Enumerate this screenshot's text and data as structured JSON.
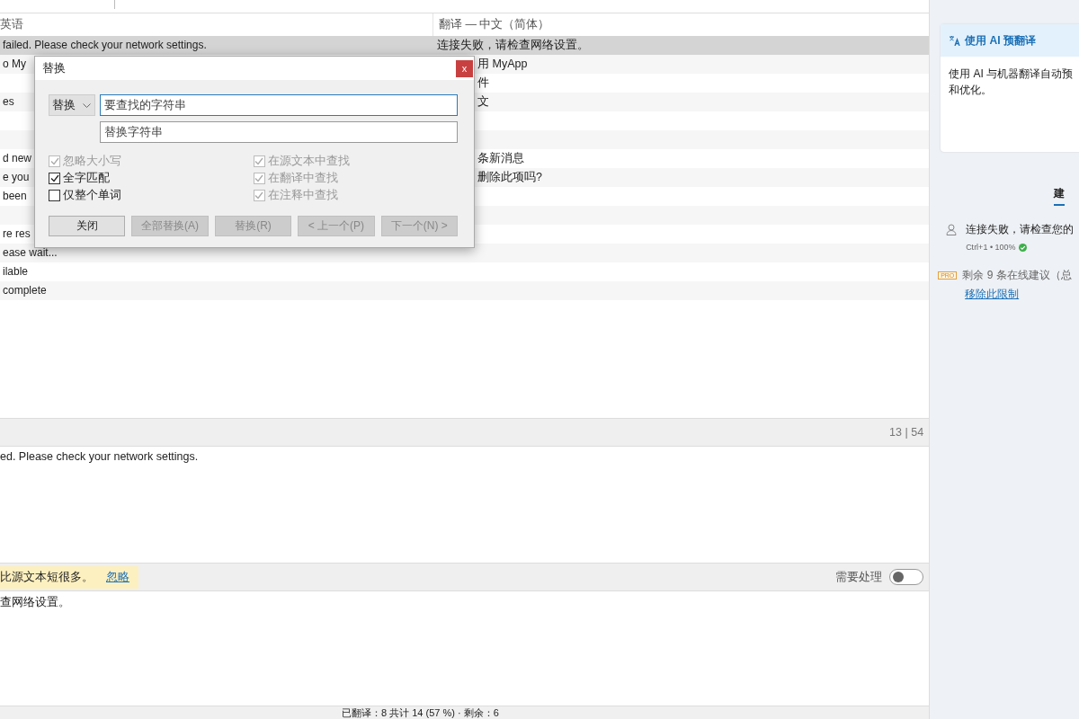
{
  "list": {
    "columns": [
      "英语",
      "翻译 — 中文（简体）"
    ],
    "rows": [
      {
        "source": "failed. Please check your network settings.",
        "translation": "连接失败，请检查网络设置。",
        "selected": true
      },
      {
        "source": "o My",
        "translation": "用 MyApp",
        "selected": false
      },
      {
        "source": "",
        "translation": "件",
        "selected": false
      },
      {
        "source": "es",
        "translation": "文",
        "selected": false
      },
      {
        "source": "",
        "translation": "",
        "selected": false
      },
      {
        "source": "",
        "translation": "",
        "selected": false
      },
      {
        "source": "d new",
        "translation": "条新消息",
        "selected": false
      },
      {
        "source": "e you",
        "translation": "删除此项吗?",
        "selected": false
      },
      {
        "source": "been",
        "translation": "",
        "selected": false
      },
      {
        "source": "",
        "translation": "",
        "selected": false
      },
      {
        "source": "re res",
        "translation": "",
        "selected": false
      },
      {
        "source": "ease wait...",
        "translation": "",
        "selected": false
      },
      {
        "source": "ilable",
        "translation": "",
        "selected": false
      },
      {
        "source": "complete",
        "translation": "",
        "selected": false
      }
    ]
  },
  "source_bar": {
    "counter": "13 | 54"
  },
  "source_text": "ed. Please check your network settings.",
  "warning_bar": {
    "message": "比源文本短很多。",
    "link": "忽略",
    "toggle_label": "需要处理",
    "toggle_on": false
  },
  "translation_text": "查网络设置。",
  "status_bar": "已翻译：8 共计 14 (57 %) · 剩余：6",
  "sidebar": {
    "card": {
      "title": "使用 AI 预翻译",
      "body_lines": [
        "使用 AI 与机器翻译自动预",
        "和优化。"
      ]
    },
    "tab": {
      "label": "建",
      "selected": true
    },
    "suggestion": {
      "text": "连接失败，请检查您的",
      "meta": "Ctrl+1 • 100%"
    },
    "pro": {
      "badge": "PRO",
      "text": "剩余 9 条在线建议（总",
      "link": "移除此限制"
    }
  },
  "dialog": {
    "title": "替换",
    "close": "x",
    "mode": "替换",
    "find_placeholder": "要查找的字符串",
    "replace_placeholder": "替换字符串",
    "left_options": [
      {
        "label": "忽略大小写",
        "checked": true,
        "disabled": true
      },
      {
        "label": "全字匹配",
        "checked": true,
        "disabled": false
      },
      {
        "label": "仅整个单词",
        "checked": false,
        "disabled": false
      }
    ],
    "right_options": [
      {
        "label": "在源文本中查找",
        "checked": true,
        "disabled": true
      },
      {
        "label": "在翻译中查找",
        "checked": true,
        "disabled": true
      },
      {
        "label": "在注释中查找",
        "checked": true,
        "disabled": true
      }
    ],
    "buttons": [
      {
        "label": "关闭",
        "disabled": false
      },
      {
        "label": "全部替换(A)",
        "disabled": true
      },
      {
        "label": "替换(R)",
        "disabled": true
      },
      {
        "label": "< 上一个(P)",
        "disabled": true
      },
      {
        "label": "下一个(N) >",
        "disabled": true
      }
    ]
  }
}
